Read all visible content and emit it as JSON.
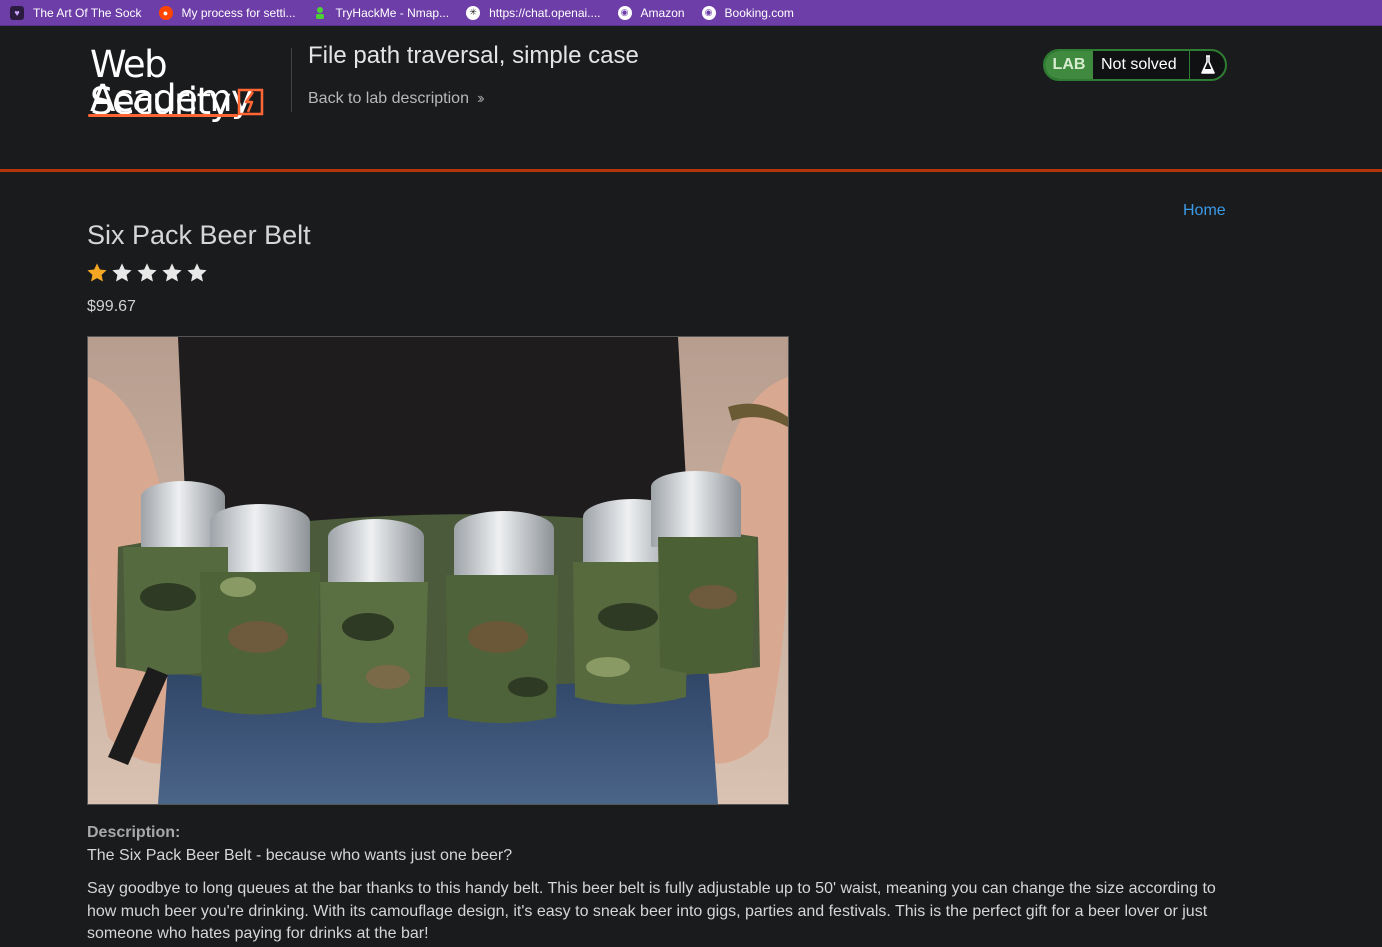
{
  "bookmarks": [
    {
      "label": "The Art Of The Sock",
      "icon": "sock-icon"
    },
    {
      "label": "My process for setti...",
      "icon": "reddit-icon"
    },
    {
      "label": "TryHackMe - Nmap...",
      "icon": "tryhackme-icon"
    },
    {
      "label": "https://chat.openai....",
      "icon": "openai-icon"
    },
    {
      "label": "Amazon",
      "icon": "globe-icon"
    },
    {
      "label": "Booking.com",
      "icon": "globe-icon"
    }
  ],
  "header": {
    "logo_line1": "Web Security",
    "logo_line2": "Academy",
    "lab_title": "File path traversal, simple case",
    "back_link": "Back to lab description",
    "lab_badge": "LAB",
    "lab_status": "Not solved"
  },
  "nav": {
    "home": "Home"
  },
  "product": {
    "title": "Six Pack Beer Belt",
    "rating": 1,
    "rating_max": 5,
    "price": "$99.67",
    "description_label": "Description:",
    "tagline": "The Six Pack Beer Belt - because who wants just one beer?",
    "description": "Say goodbye to long queues at the bar thanks to this handy belt. This beer belt is fully adjustable up to 50' waist, meaning you can change the size according to how much beer you're drinking. With its camouflage design, it's easy to sneak beer into gigs, parties and festivals. This is the perfect gift for a beer lover or just someone who hates paying for drinks at the bar!"
  },
  "colors": {
    "bookmarks_bar": "#6e3ea8",
    "background": "#1a1b1d",
    "accent_rule": "#b3350a",
    "link": "#3b9ae8",
    "star_filled": "#f5a623",
    "star_empty": "#e8e8e8",
    "lab_green": "#3f8a3f"
  }
}
